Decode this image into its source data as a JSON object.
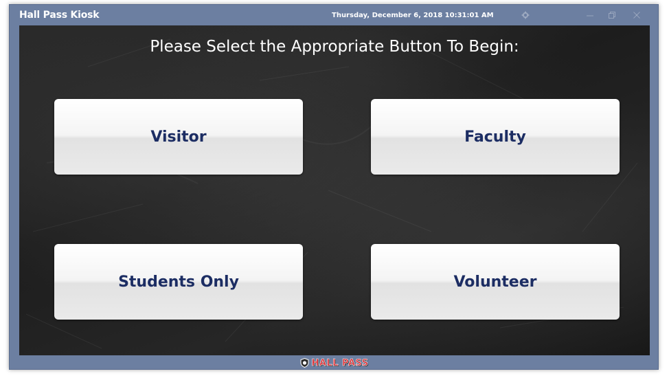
{
  "window": {
    "title": "Hall Pass Kiosk",
    "datetime": "Thursday, December 6, 2018 10:31:01 AM"
  },
  "controls": {
    "settings_icon": "gear-icon",
    "minimize_icon": "minimize-icon",
    "maximize_icon": "maximize-icon",
    "close_icon": "close-icon"
  },
  "main": {
    "prompt": "Please Select the Appropriate Button To Begin:",
    "buttons": [
      {
        "label": "Visitor"
      },
      {
        "label": "Faculty"
      },
      {
        "label": "Students Only"
      },
      {
        "label": "Volunteer"
      }
    ]
  },
  "footer": {
    "logo_text": "HALL PASS"
  },
  "colors": {
    "titlebar": "#6c7fa1",
    "button_text": "#1c2d63",
    "logo_red": "#d8262e"
  }
}
